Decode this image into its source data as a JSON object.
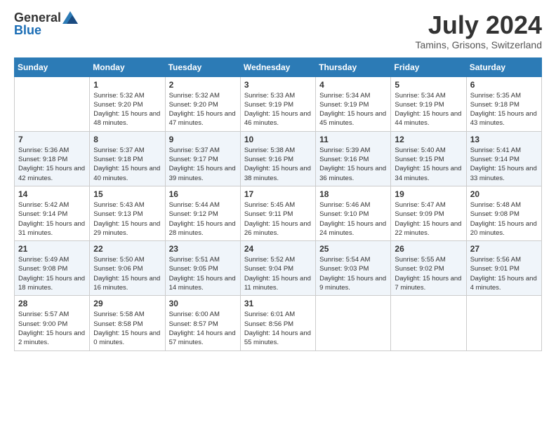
{
  "header": {
    "logo_general": "General",
    "logo_blue": "Blue",
    "month_year": "July 2024",
    "location": "Tamins, Grisons, Switzerland"
  },
  "weekdays": [
    "Sunday",
    "Monday",
    "Tuesday",
    "Wednesday",
    "Thursday",
    "Friday",
    "Saturday"
  ],
  "weeks": [
    [
      {
        "day": "",
        "sunrise": "",
        "sunset": "",
        "daylight": ""
      },
      {
        "day": "1",
        "sunrise": "Sunrise: 5:32 AM",
        "sunset": "Sunset: 9:20 PM",
        "daylight": "Daylight: 15 hours and 48 minutes."
      },
      {
        "day": "2",
        "sunrise": "Sunrise: 5:32 AM",
        "sunset": "Sunset: 9:20 PM",
        "daylight": "Daylight: 15 hours and 47 minutes."
      },
      {
        "day": "3",
        "sunrise": "Sunrise: 5:33 AM",
        "sunset": "Sunset: 9:19 PM",
        "daylight": "Daylight: 15 hours and 46 minutes."
      },
      {
        "day": "4",
        "sunrise": "Sunrise: 5:34 AM",
        "sunset": "Sunset: 9:19 PM",
        "daylight": "Daylight: 15 hours and 45 minutes."
      },
      {
        "day": "5",
        "sunrise": "Sunrise: 5:34 AM",
        "sunset": "Sunset: 9:19 PM",
        "daylight": "Daylight: 15 hours and 44 minutes."
      },
      {
        "day": "6",
        "sunrise": "Sunrise: 5:35 AM",
        "sunset": "Sunset: 9:18 PM",
        "daylight": "Daylight: 15 hours and 43 minutes."
      }
    ],
    [
      {
        "day": "7",
        "sunrise": "Sunrise: 5:36 AM",
        "sunset": "Sunset: 9:18 PM",
        "daylight": "Daylight: 15 hours and 42 minutes."
      },
      {
        "day": "8",
        "sunrise": "Sunrise: 5:37 AM",
        "sunset": "Sunset: 9:18 PM",
        "daylight": "Daylight: 15 hours and 40 minutes."
      },
      {
        "day": "9",
        "sunrise": "Sunrise: 5:37 AM",
        "sunset": "Sunset: 9:17 PM",
        "daylight": "Daylight: 15 hours and 39 minutes."
      },
      {
        "day": "10",
        "sunrise": "Sunrise: 5:38 AM",
        "sunset": "Sunset: 9:16 PM",
        "daylight": "Daylight: 15 hours and 38 minutes."
      },
      {
        "day": "11",
        "sunrise": "Sunrise: 5:39 AM",
        "sunset": "Sunset: 9:16 PM",
        "daylight": "Daylight: 15 hours and 36 minutes."
      },
      {
        "day": "12",
        "sunrise": "Sunrise: 5:40 AM",
        "sunset": "Sunset: 9:15 PM",
        "daylight": "Daylight: 15 hours and 34 minutes."
      },
      {
        "day": "13",
        "sunrise": "Sunrise: 5:41 AM",
        "sunset": "Sunset: 9:14 PM",
        "daylight": "Daylight: 15 hours and 33 minutes."
      }
    ],
    [
      {
        "day": "14",
        "sunrise": "Sunrise: 5:42 AM",
        "sunset": "Sunset: 9:14 PM",
        "daylight": "Daylight: 15 hours and 31 minutes."
      },
      {
        "day": "15",
        "sunrise": "Sunrise: 5:43 AM",
        "sunset": "Sunset: 9:13 PM",
        "daylight": "Daylight: 15 hours and 29 minutes."
      },
      {
        "day": "16",
        "sunrise": "Sunrise: 5:44 AM",
        "sunset": "Sunset: 9:12 PM",
        "daylight": "Daylight: 15 hours and 28 minutes."
      },
      {
        "day": "17",
        "sunrise": "Sunrise: 5:45 AM",
        "sunset": "Sunset: 9:11 PM",
        "daylight": "Daylight: 15 hours and 26 minutes."
      },
      {
        "day": "18",
        "sunrise": "Sunrise: 5:46 AM",
        "sunset": "Sunset: 9:10 PM",
        "daylight": "Daylight: 15 hours and 24 minutes."
      },
      {
        "day": "19",
        "sunrise": "Sunrise: 5:47 AM",
        "sunset": "Sunset: 9:09 PM",
        "daylight": "Daylight: 15 hours and 22 minutes."
      },
      {
        "day": "20",
        "sunrise": "Sunrise: 5:48 AM",
        "sunset": "Sunset: 9:08 PM",
        "daylight": "Daylight: 15 hours and 20 minutes."
      }
    ],
    [
      {
        "day": "21",
        "sunrise": "Sunrise: 5:49 AM",
        "sunset": "Sunset: 9:08 PM",
        "daylight": "Daylight: 15 hours and 18 minutes."
      },
      {
        "day": "22",
        "sunrise": "Sunrise: 5:50 AM",
        "sunset": "Sunset: 9:06 PM",
        "daylight": "Daylight: 15 hours and 16 minutes."
      },
      {
        "day": "23",
        "sunrise": "Sunrise: 5:51 AM",
        "sunset": "Sunset: 9:05 PM",
        "daylight": "Daylight: 15 hours and 14 minutes."
      },
      {
        "day": "24",
        "sunrise": "Sunrise: 5:52 AM",
        "sunset": "Sunset: 9:04 PM",
        "daylight": "Daylight: 15 hours and 11 minutes."
      },
      {
        "day": "25",
        "sunrise": "Sunrise: 5:54 AM",
        "sunset": "Sunset: 9:03 PM",
        "daylight": "Daylight: 15 hours and 9 minutes."
      },
      {
        "day": "26",
        "sunrise": "Sunrise: 5:55 AM",
        "sunset": "Sunset: 9:02 PM",
        "daylight": "Daylight: 15 hours and 7 minutes."
      },
      {
        "day": "27",
        "sunrise": "Sunrise: 5:56 AM",
        "sunset": "Sunset: 9:01 PM",
        "daylight": "Daylight: 15 hours and 4 minutes."
      }
    ],
    [
      {
        "day": "28",
        "sunrise": "Sunrise: 5:57 AM",
        "sunset": "Sunset: 9:00 PM",
        "daylight": "Daylight: 15 hours and 2 minutes."
      },
      {
        "day": "29",
        "sunrise": "Sunrise: 5:58 AM",
        "sunset": "Sunset: 8:58 PM",
        "daylight": "Daylight: 15 hours and 0 minutes."
      },
      {
        "day": "30",
        "sunrise": "Sunrise: 6:00 AM",
        "sunset": "Sunset: 8:57 PM",
        "daylight": "Daylight: 14 hours and 57 minutes."
      },
      {
        "day": "31",
        "sunrise": "Sunrise: 6:01 AM",
        "sunset": "Sunset: 8:56 PM",
        "daylight": "Daylight: 14 hours and 55 minutes."
      },
      {
        "day": "",
        "sunrise": "",
        "sunset": "",
        "daylight": ""
      },
      {
        "day": "",
        "sunrise": "",
        "sunset": "",
        "daylight": ""
      },
      {
        "day": "",
        "sunrise": "",
        "sunset": "",
        "daylight": ""
      }
    ]
  ]
}
